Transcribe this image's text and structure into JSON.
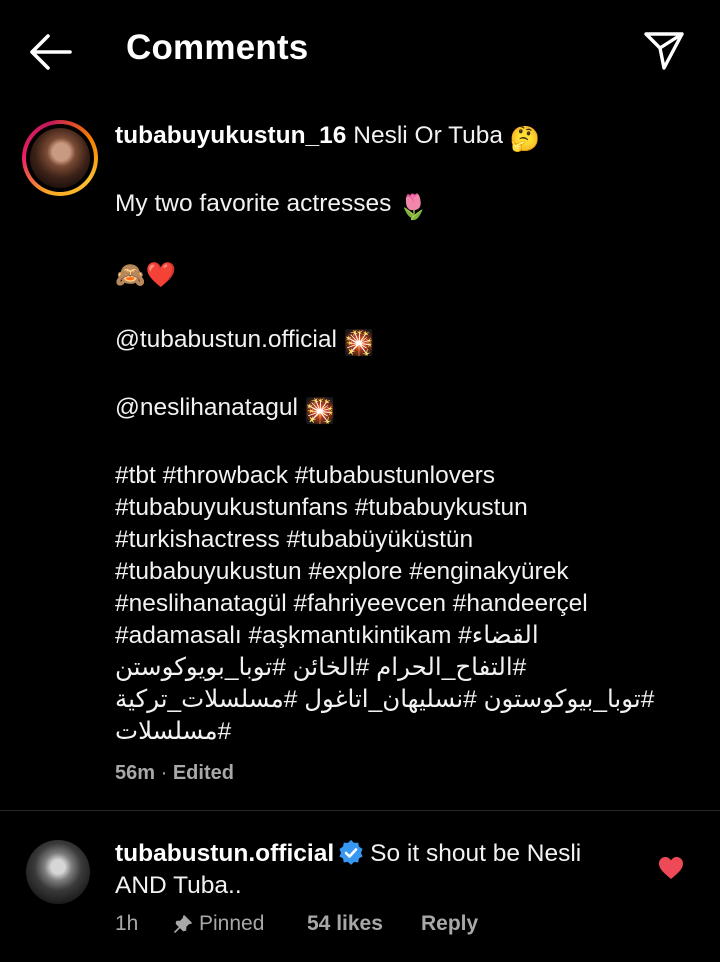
{
  "header": {
    "title": "Comments",
    "back_icon": "back-arrow-icon",
    "share_icon": "paper-plane-icon"
  },
  "caption": {
    "username": "tubabuyukustun_16",
    "first_text": "Nesli Or Tuba",
    "first_emoji": "🤔",
    "line2_text": "My  two favorite actresses",
    "line2_emoji": "🌷",
    "line3_emoji": "🙈❤️",
    "mention1": "@tubabustun.official",
    "mention1_emoji": "🎇",
    "mention2": "@neslihanatagul",
    "mention2_emoji": "🎇",
    "hashtag_lines": [
      "#tbt #throwback #tubabustunlovers",
      "#tubabuyukustunfans #tubabuykustun",
      "#turkishactress #tubabüyüküstün",
      "#tubabuyukustun #explore #enginakyürek",
      "#neslihanatagül #fahriyeevcen #handeerçel",
      "#adamasalı #aşkmantıkintikam #القضاء",
      "#التفاح_الحرام #الخائن #توبا_بويوكوستن",
      "#توبا_بيوكوستون #نسليهان_اتاغول #مسلسلات_تركية",
      "#مسلسلات"
    ],
    "time": "56m",
    "separator": "·",
    "edited_label": "Edited"
  },
  "comment": {
    "username": "tubabustun.official",
    "verified_icon": "verified-badge-icon",
    "text_part1": "So it shout be Nesli",
    "text_part2": "AND Tuba..",
    "age": "1h",
    "pinned_label": "Pinned",
    "likes": "54 likes",
    "reply_label": "Reply",
    "liked": true,
    "heart_color": "#ed4956"
  },
  "colors": {
    "background": "#000000",
    "text": "#f5f5f5",
    "secondary_text": "#a8a8a8",
    "verified_blue": "#3897f0"
  }
}
